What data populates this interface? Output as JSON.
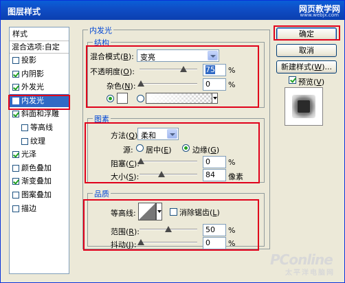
{
  "window": {
    "title": "图层样式",
    "watermark": "网页教学网",
    "watermark_url": "www.webjx.com"
  },
  "list": {
    "header": "样式",
    "blend_options": "混合选项:自定",
    "items": [
      {
        "label": "投影",
        "checked": false
      },
      {
        "label": "内阴影",
        "checked": true
      },
      {
        "label": "外发光",
        "checked": true
      },
      {
        "label": "内发光",
        "checked": true,
        "selected": true
      },
      {
        "label": "斜面和浮雕",
        "checked": true
      },
      {
        "label": "等高线",
        "checked": false,
        "indent": true
      },
      {
        "label": "纹理",
        "checked": false,
        "indent": true
      },
      {
        "label": "光泽",
        "checked": true
      },
      {
        "label": "颜色叠加",
        "checked": false
      },
      {
        "label": "渐变叠加",
        "checked": true
      },
      {
        "label": "图案叠加",
        "checked": false
      },
      {
        "label": "描边",
        "checked": false
      }
    ]
  },
  "panel": {
    "title": "内发光",
    "structure": {
      "title": "结构",
      "blend_mode_label": "混合模式(",
      "blend_mode_key": "B",
      "blend_mode_value": "变亮",
      "opacity_label": "不透明度(",
      "opacity_key": "O",
      "opacity_value": "75",
      "noise_label": "杂色(",
      "noise_key": "N",
      "noise_value": "0",
      "percent": "%",
      "color_mode": "solid"
    },
    "elements": {
      "title": "图素",
      "method_label": "方法(",
      "method_key": "Q",
      "method_value": "柔和",
      "source_label": "源:",
      "center_label": "居中(",
      "center_key": "E",
      "edge_label": "边缘(",
      "edge_key": "G",
      "source_value": "edge",
      "choke_label": "阻塞(",
      "choke_key": "C",
      "choke_value": "0",
      "size_label": "大小(",
      "size_key": "S",
      "size_value": "84",
      "size_unit": "像素",
      "percent": "%"
    },
    "quality": {
      "title": "品质",
      "contour_label": "等高线:",
      "antialias_label": "消除锯齿(",
      "antialias_key": "L",
      "antialias_checked": false,
      "range_label": "范围(",
      "range_key": "R",
      "range_value": "50",
      "jitter_label": "抖动(",
      "jitter_key": "J",
      "jitter_value": "0",
      "percent": "%"
    }
  },
  "buttons": {
    "ok": "确定",
    "cancel": "取消",
    "new_style": "新建样式(",
    "new_style_key": "W",
    "new_style_tail": ")...",
    "preview_label": "预览(",
    "preview_key": "V",
    "preview_checked": true
  },
  "branding": {
    "pconline": "PConline",
    "pconline_sub": "太平洋电脑网"
  },
  "colors": {
    "title_bar": "#0a5fd8",
    "selection": "#316ac5",
    "highlight_box": "#e0001a",
    "check": "#21a121"
  }
}
